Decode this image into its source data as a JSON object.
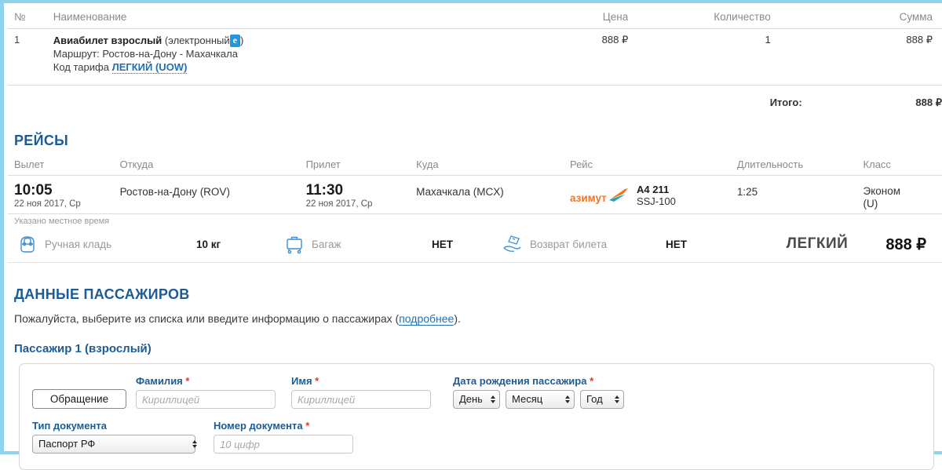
{
  "order": {
    "columns": [
      "№",
      "Наименование",
      "Цена",
      "Количество",
      "Сумма"
    ],
    "row": {
      "num": "1",
      "title_bold": "Авиабилет взрослый",
      "title_rest_open": "(электронный",
      "badge": "e",
      "title_rest_close": ")",
      "route_line": "Маршрут: Ростов-на-Дону - Махачкала",
      "fare_prefix": "Код тарифа",
      "fare_link": "ЛЕГКИЙ (UOW)",
      "price": "888 ₽",
      "qty": "1",
      "sum": "888 ₽"
    },
    "total_label": "Итого:",
    "total_value": "888 ₽"
  },
  "flights": {
    "heading": "РЕЙСЫ",
    "columns": [
      "Вылет",
      "Откуда",
      "Прилет",
      "Куда",
      "Рейс",
      "Длительность",
      "Класс"
    ],
    "row": {
      "departure_time": "10:05",
      "departure_date": "22 ноя 2017, Ср",
      "from": "Ростов-на-Дону (ROV)",
      "arrival_time": "11:30",
      "arrival_date": "22 ноя 2017, Ср",
      "to": "Махачкала (MCX)",
      "airline_logo_text": "азимут",
      "flight_number": "A4 211",
      "aircraft": "SSJ-100",
      "duration": "1:25",
      "class_name": "Эконом",
      "class_code": "(U)"
    },
    "local_time_note": "Указано местное время"
  },
  "services": {
    "hand_luggage": {
      "icon": "backpack-icon",
      "label": "Ручная кладь",
      "value": "10 кг"
    },
    "baggage": {
      "icon": "luggage-cart-icon",
      "label": "Багаж",
      "value": "НЕТ"
    },
    "refund": {
      "icon": "ticket-hand-icon",
      "label": "Возврат билета",
      "value": "НЕТ"
    },
    "fare_name": "ЛЕГКИЙ",
    "fare_price": "888 ₽"
  },
  "passengers": {
    "heading": "ДАННЫЕ ПАССАЖИРОВ",
    "intro_before": "Пожалуйста, выберите из списка или введите информацию о пассажирах (",
    "intro_link": "подробнее",
    "intro_after": ").",
    "pax_title": "Пассажир 1 (взрослый)",
    "form": {
      "salutation_button": "Обращение",
      "surname_label": "Фамилия",
      "surname_placeholder": "Кириллицей",
      "surname_value": "",
      "name_label": "Имя",
      "name_placeholder": "Кириллицей",
      "name_value": "",
      "birth_label": "Дата рождения пассажира",
      "day_selected": "День",
      "month_selected": "Месяц",
      "year_selected": "Год",
      "doc_type_label": "Тип документа",
      "doc_type_selected": "Паспорт РФ",
      "doc_num_label": "Номер документа",
      "doc_num_placeholder": "10 цифр",
      "doc_num_value": "",
      "required_mark": "*"
    }
  },
  "colors": {
    "frame": "#8fd3ec",
    "heading_blue": "#1c5c95",
    "link_blue": "#1f6fb5",
    "required_red": "#e0392b",
    "badge_blue": "#2196e3",
    "airline_orange": "#ef7622",
    "airline_teal": "#19a6bd",
    "muted_gray": "#8a8a8a"
  }
}
